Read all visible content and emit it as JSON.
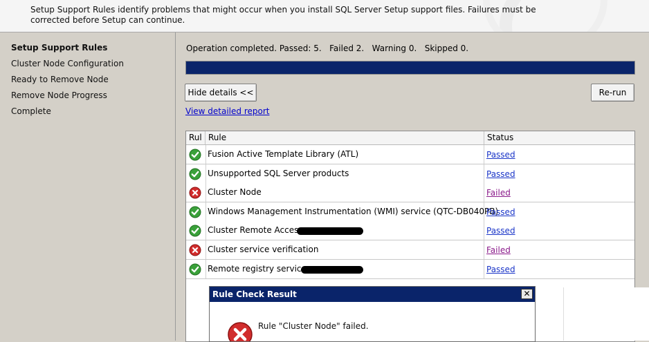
{
  "header": {
    "description": "Setup Support Rules identify problems that might occur when you install SQL Server Setup support files. Failures must be corrected before Setup can continue."
  },
  "nav": {
    "steps": [
      {
        "label": "Setup Support Rules",
        "active": true
      },
      {
        "label": "Cluster Node Configuration",
        "active": false
      },
      {
        "label": "Ready to Remove Node",
        "active": false
      },
      {
        "label": "Remove Node Progress",
        "active": false
      },
      {
        "label": "Complete",
        "active": false
      }
    ]
  },
  "main": {
    "status_text": "Operation completed. Passed: 5.   Failed 2.   Warning 0.   Skipped 0.",
    "progress_percent": 100,
    "hide_details_label": "Hide details <<",
    "rerun_label": "Re-run",
    "report_link": "View detailed report"
  },
  "grid": {
    "headers": {
      "icon": "Rul",
      "rule": "Rule",
      "status": "Status"
    },
    "rows": [
      {
        "rule": "Fusion Active Template Library (ATL)",
        "status": "Passed",
        "result": "pass"
      },
      {
        "rule": "Unsupported SQL Server products",
        "status": "Passed",
        "result": "pass"
      },
      {
        "rule": "Cluster Node",
        "status": "Failed",
        "result": "fail"
      },
      {
        "rule": "Windows Management Instrumentation (WMI) service (QTC-DB040PB)",
        "status": "Passed",
        "result": "pass"
      },
      {
        "rule": "Cluster Remote Access",
        "status": "Passed",
        "result": "pass",
        "redacted": true
      },
      {
        "rule": "Cluster service verification",
        "status": "Failed",
        "result": "fail"
      },
      {
        "rule": "Remote registry service",
        "status": "Passed",
        "result": "pass",
        "redacted": true
      }
    ]
  },
  "dialog": {
    "title": "Rule Check Result",
    "close_label": "✕",
    "message": "Rule \"Cluster Node\" failed."
  },
  "colors": {
    "pass": "#3aa13a",
    "fail": "#d12d2d",
    "progress": "#0a246a"
  },
  "icons": {
    "pass": "checkmark-icon",
    "fail": "error-icon"
  }
}
